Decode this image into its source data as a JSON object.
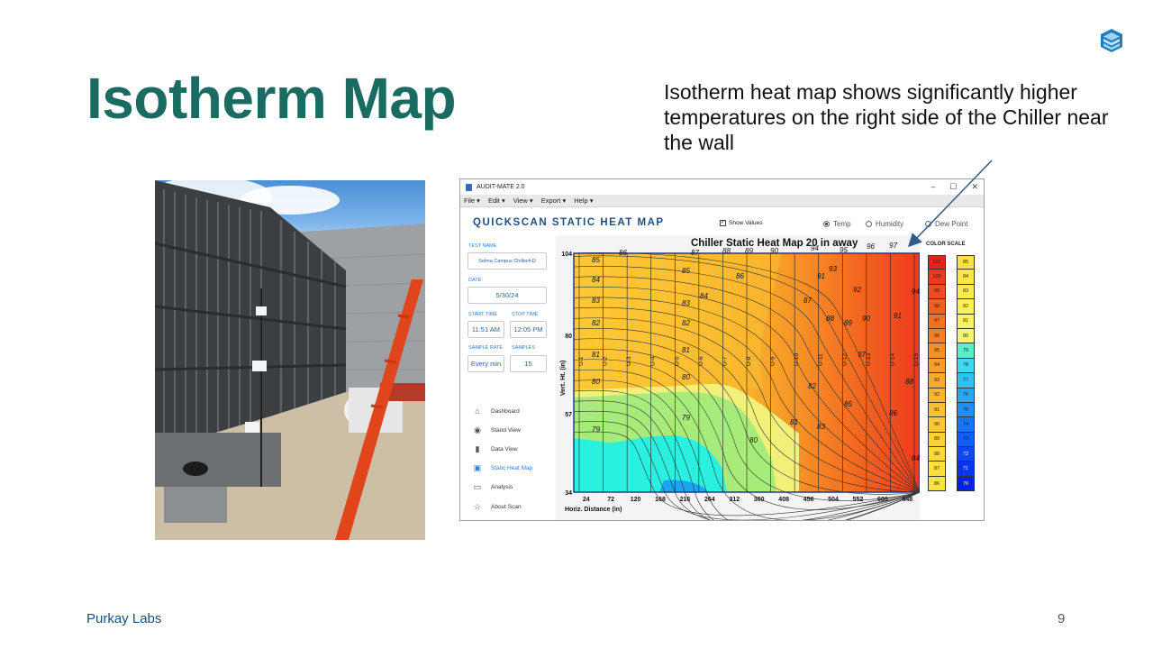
{
  "slide": {
    "title": "Isotherm Map",
    "callout": "Isotherm heat map shows significantly higher temperatures on the right side of the Chiller near the wall",
    "footer_left": "Purkay Labs",
    "page_number": "9"
  },
  "app": {
    "window_title": "AUDIT-MATE 2.0",
    "window_controls": [
      "–",
      "☐",
      "✕"
    ],
    "menu": [
      "File ▾",
      "Edit ▾",
      "View ▾",
      "Export ▾",
      "Help ▾"
    ],
    "heading": "QUICKSCAN STATIC HEAT MAP",
    "show_values_label": "Show Values",
    "show_values_checked": true,
    "radio_options": [
      {
        "label": "Temp",
        "selected": true
      },
      {
        "label": "Humidity",
        "selected": false
      },
      {
        "label": "Dew Point",
        "selected": false
      }
    ],
    "fields": {
      "test_name_label": "TEST NAME",
      "test_name": "Selma Campus Chiller4-D",
      "date_label": "DATE",
      "date": "5/30/24",
      "start_time_label": "START TIME",
      "start_time": "11:51 AM",
      "stop_time_label": "STOP TIME",
      "stop_time": "12:05 PM",
      "sample_rate_label": "SAMPLE RATE",
      "sample_rate": "Every min",
      "samples_label": "SAMPLES",
      "samples": "15"
    },
    "nav": [
      {
        "label": "Dashboard",
        "icon": "home-icon",
        "active": false
      },
      {
        "label": "Stand View",
        "icon": "location-pin-icon",
        "active": false
      },
      {
        "label": "Data View",
        "icon": "bar-chart-icon",
        "active": false
      },
      {
        "label": "Static Heat Map",
        "icon": "heat-map-icon",
        "active": true
      },
      {
        "label": "Analysis",
        "icon": "analysis-icon",
        "active": false
      },
      {
        "label": "About Scan",
        "icon": "star-icon",
        "active": false
      }
    ],
    "color_scale_title": "COLOR SCALE",
    "color_scale": [
      {
        "v": "101",
        "c": "#e8231c"
      },
      {
        "v": "100",
        "c": "#ec3a1d"
      },
      {
        "v": "99",
        "c": "#ef4d1f"
      },
      {
        "v": "98",
        "c": "#f15f20"
      },
      {
        "v": "97",
        "c": "#f37022"
      },
      {
        "v": "96",
        "c": "#f58023"
      },
      {
        "v": "95",
        "c": "#f78f25"
      },
      {
        "v": "94",
        "c": "#f89d28"
      },
      {
        "v": "93",
        "c": "#f9a92b"
      },
      {
        "v": "92",
        "c": "#fab42e"
      },
      {
        "v": "91",
        "c": "#fbbf31"
      },
      {
        "v": "90",
        "c": "#fcc834"
      },
      {
        "v": "89",
        "c": "#fdd137"
      },
      {
        "v": "88",
        "c": "#fdd93a"
      },
      {
        "v": "87",
        "c": "#fde03c"
      },
      {
        "v": "86",
        "c": "#fde53f"
      },
      {
        "v": "85",
        "c": "#fde141"
      },
      {
        "v": "84",
        "c": "#fde646"
      },
      {
        "v": "83",
        "c": "#fdeb4d"
      },
      {
        "v": "82",
        "c": "#fdef56"
      },
      {
        "v": "81",
        "c": "#fcf262"
      },
      {
        "v": "80",
        "c": "#f8f570"
      },
      {
        "v": "79",
        "c": "#5cf0c9"
      },
      {
        "v": "78",
        "c": "#3fd9f0"
      },
      {
        "v": "77",
        "c": "#31c2f2"
      },
      {
        "v": "76",
        "c": "#27a8f4"
      },
      {
        "v": "75",
        "c": "#1e8ff6"
      },
      {
        "v": "74",
        "c": "#1676f6"
      },
      {
        "v": "73",
        "c": "#105ff6"
      },
      {
        "v": "72",
        "c": "#0b48f3"
      },
      {
        "v": "71",
        "c": "#0734ef"
      },
      {
        "v": "70",
        "c": "#0422e6"
      }
    ]
  },
  "chart_data": {
    "type": "heatmap",
    "title": "Chiller Static Heat Map 20 in away",
    "xlabel": "Horiz. Distance (in)",
    "ylabel": "Vert. Ht. (in)",
    "x_ticks": [
      24,
      72,
      120,
      168,
      216,
      264,
      312,
      360,
      408,
      456,
      504,
      552,
      600,
      648
    ],
    "y_ticks": [
      34,
      57,
      80,
      104
    ],
    "sensor_units": [
      "U-1",
      "U-2",
      "U-3",
      "U-4",
      "U-5",
      "U-6",
      "U-7",
      "U-8",
      "U-9",
      "U-10",
      "U-11",
      "U-12",
      "U-13",
      "U-14",
      "U-15"
    ],
    "isotherm_labels": [
      79,
      80,
      81,
      82,
      83,
      84,
      85,
      86,
      87,
      88,
      89,
      90,
      91,
      92,
      93,
      94,
      95,
      96,
      97
    ],
    "temp_range": [
      70,
      101
    ]
  }
}
